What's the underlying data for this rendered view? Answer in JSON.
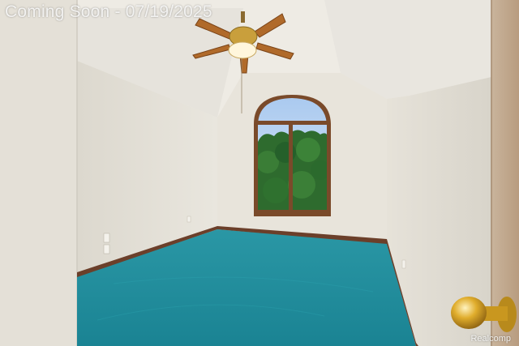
{
  "photo": {
    "watermark": "Coming Soon - 07/19/2025",
    "credit": "Realcomp"
  },
  "colors": {
    "carpet": "#1f8f9e",
    "wall": "#e7e3da",
    "ceiling": "#eeebe4",
    "trim": "#6b3f2a",
    "window_frame": "#7a4a2a",
    "foliage": "#2e6b2e",
    "door_knob": "#d9a520"
  }
}
